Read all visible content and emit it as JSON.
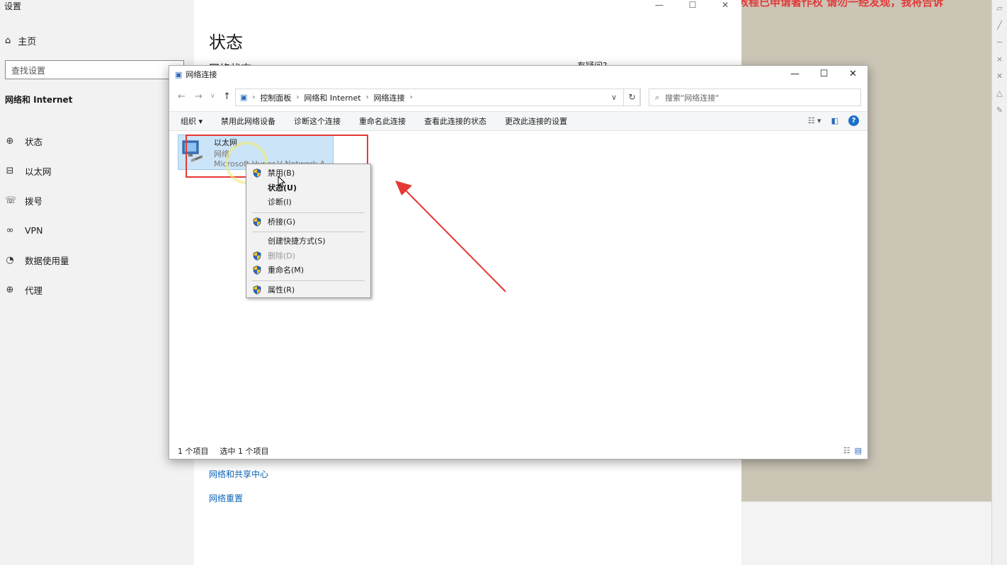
{
  "settings": {
    "app_title": "设置",
    "home": "主页",
    "search_placeholder": "查找设置",
    "section": "网络和 Internet",
    "nav": [
      {
        "icon": "globe-status-icon",
        "glyph": "⊕",
        "label": "状态"
      },
      {
        "icon": "ethernet-icon",
        "glyph": "⊟",
        "label": "以太网"
      },
      {
        "icon": "dialup-icon",
        "glyph": "☏",
        "label": "拨号"
      },
      {
        "icon": "vpn-icon",
        "glyph": "∞",
        "label": "VPN"
      },
      {
        "icon": "data-usage-icon",
        "glyph": "◔",
        "label": "数据使用量"
      },
      {
        "icon": "proxy-icon",
        "glyph": "⊕",
        "label": "代理"
      }
    ],
    "page_title": "状态",
    "subtitle_partial": "网络状态",
    "help_partial": "有疑问?",
    "links": [
      "网络和共享中心",
      "网络重置"
    ]
  },
  "window": {
    "title": "网络连接",
    "breadcrumb": [
      "控制面板",
      "网络和 Internet",
      "网络连接"
    ],
    "search_placeholder": "搜索\"网络连接\"",
    "toolbar": [
      "组织 ▾",
      "禁用此网络设备",
      "诊断这个连接",
      "重命名此连接",
      "查看此连接的状态",
      "更改此连接的设置"
    ],
    "item": {
      "name": "以太网",
      "kind": "网络",
      "device": "Microsoft Hyper-V Network A..."
    },
    "status": {
      "count": "1 个项目",
      "selected": "选中 1 个项目"
    }
  },
  "context_menu": [
    {
      "label": "禁用(B)",
      "shield": true
    },
    {
      "label": "状态(U)",
      "bold": true
    },
    {
      "label": "诊断(I)"
    },
    {
      "sep": true
    },
    {
      "label": "桥接(G)",
      "shield": true
    },
    {
      "sep": true
    },
    {
      "label": "创建快捷方式(S)"
    },
    {
      "label": "删除(D)",
      "shield": true,
      "disabled": true
    },
    {
      "label": "重命名(M)",
      "shield": true
    },
    {
      "sep": true
    },
    {
      "label": "属性(R)",
      "shield": true
    }
  ],
  "background": {
    "banner": "此教程已申请著作权 请勿一经发现，我将告诉"
  },
  "colors": {
    "annotation": "#e53935",
    "selection": "#cce4f7",
    "link": "#0b63b5"
  }
}
